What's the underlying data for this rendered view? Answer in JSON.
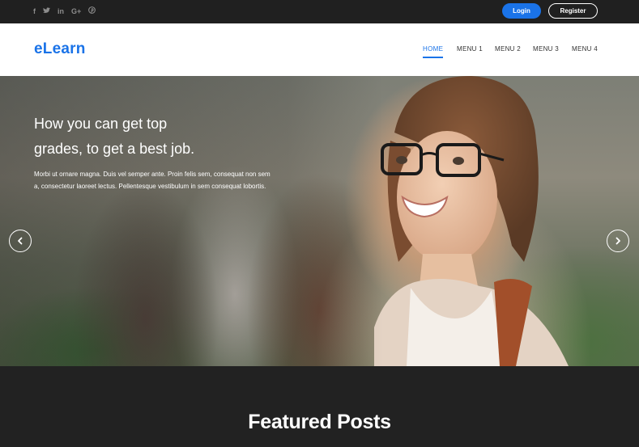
{
  "topbar": {
    "social": [
      {
        "icon": "facebook-icon",
        "glyph": "f"
      },
      {
        "icon": "twitter-icon",
        "glyph": "t"
      },
      {
        "icon": "linkedin-icon",
        "glyph": "in"
      },
      {
        "icon": "google-plus-icon",
        "glyph": "G+"
      },
      {
        "icon": "pinterest-icon",
        "glyph": "℗"
      }
    ],
    "login_label": "Login",
    "register_label": "Register"
  },
  "header": {
    "logo": "eLearn",
    "menu": [
      "HOME",
      "MENU 1",
      "MENU 2",
      "MENU 3",
      "MENU 4"
    ],
    "active_menu": "HOME"
  },
  "hero": {
    "headline_line1": "How you can get top",
    "headline_line2": "grades, to get a best job.",
    "text": "Morbi ut ornare magna. Duis vel semper ante. Proin felis sem, consequat non sem a, consectetur laoreet lectus. Pellentesque vestibulum in sem consequat lobortis."
  },
  "featured": {
    "title": "Featured Posts"
  },
  "colors": {
    "accent": "#1a73e8",
    "topbar_bg": "#202020",
    "footer_bg": "#222222"
  }
}
